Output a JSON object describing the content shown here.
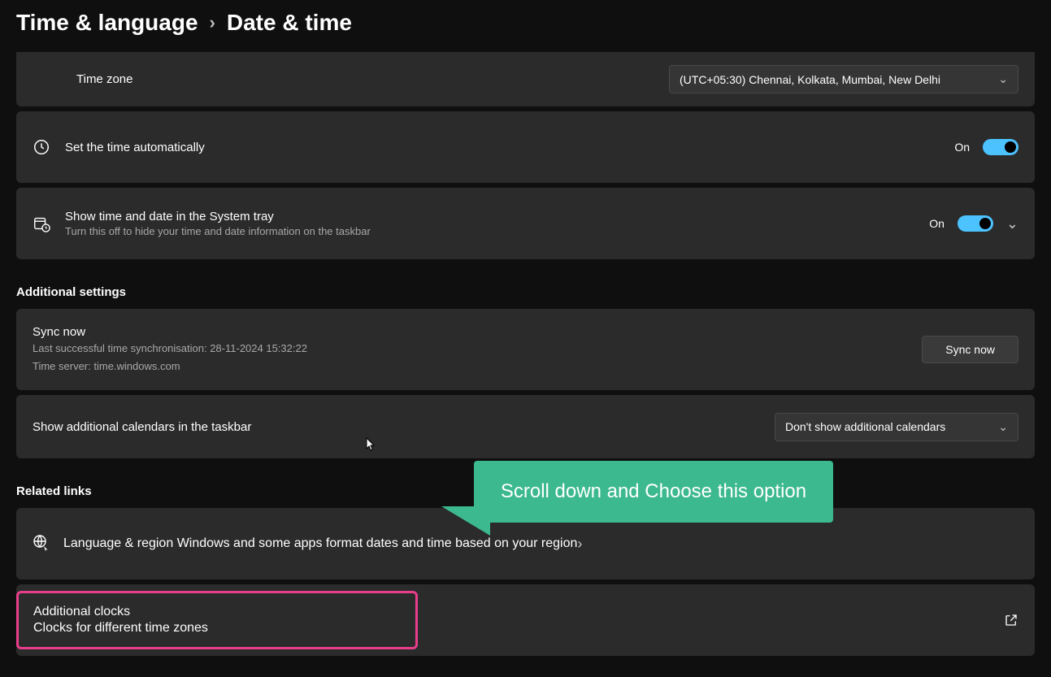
{
  "breadcrumb": {
    "parent": "Time & language",
    "current": "Date & time"
  },
  "timezone": {
    "label": "Time zone",
    "selected": "(UTC+05:30) Chennai, Kolkata, Mumbai, New Delhi"
  },
  "autoTime": {
    "label": "Set the time automatically",
    "state": "On"
  },
  "systray": {
    "title": "Show time and date in the System tray",
    "sub": "Turn this off to hide your time and date information on the taskbar",
    "state": "On"
  },
  "sections": {
    "additional": "Additional settings",
    "related": "Related links"
  },
  "sync": {
    "title": "Sync now",
    "line1": "Last successful time synchronisation: 28-11-2024 15:32:22",
    "line2": "Time server: time.windows.com",
    "button": "Sync now"
  },
  "calendars": {
    "label": "Show additional calendars in the taskbar",
    "selected": "Don't show additional calendars"
  },
  "langRegion": {
    "title": "Language & region",
    "sub": "Windows and some apps format dates and time based on your region"
  },
  "addClocks": {
    "title": "Additional clocks",
    "sub": "Clocks for different time zones"
  },
  "callout": "Scroll down and Choose this option"
}
